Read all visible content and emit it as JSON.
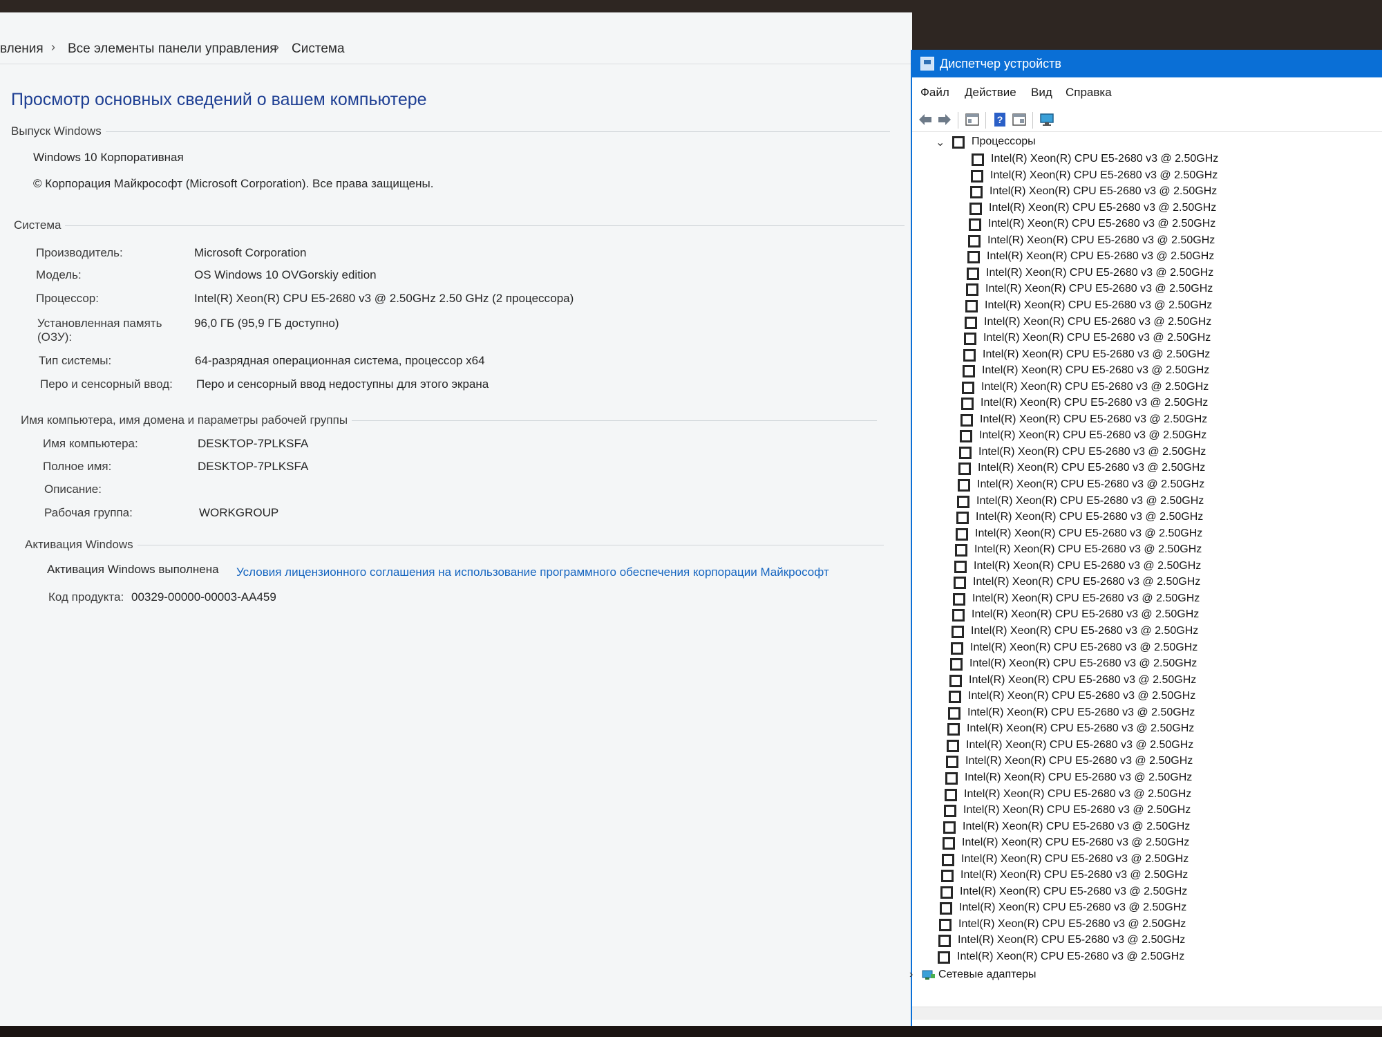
{
  "system_window": {
    "breadcrumb": [
      "вления",
      "Все элементы панели управления",
      "Система"
    ],
    "page_title": "Просмотр основных сведений о вашем компьютере",
    "windows_edition": {
      "heading": "Выпуск Windows",
      "edition": "Windows 10 Корпоративная",
      "copyright": "© Корпорация Майкрософт (Microsoft Corporation). Все права защищены."
    },
    "system": {
      "heading": "Система",
      "manufacturer_label": "Производитель:",
      "manufacturer_value": "Microsoft Corporation",
      "model_label": "Модель:",
      "model_value": "OS Windows 10 OVGorskiy edition",
      "processor_label": "Процессор:",
      "processor_value": "Intel(R) Xeon(R) CPU E5-2680 v3 @ 2.50GHz   2.50 GHz  (2 процессора)",
      "memory_label_1": "Установленная память",
      "memory_label_2": "(ОЗУ):",
      "memory_value": "96,0 ГБ (95,9 ГБ доступно)",
      "system_type_label": "Тип системы:",
      "system_type_value": "64-разрядная операционная система, процессор x64",
      "pen_label": "Перо и сенсорный ввод:",
      "pen_value": "Перо и сенсорный ввод недоступны для этого экрана"
    },
    "computer_name": {
      "heading": "Имя компьютера, имя домена и параметры рабочей группы",
      "name_label": "Имя компьютера:",
      "name_value": "DESKTOP-7PLKSFA",
      "full_name_label": "Полное имя:",
      "full_name_value": "DESKTOP-7PLKSFA",
      "description_label": "Описание:",
      "workgroup_label": "Рабочая группа:",
      "workgroup_value": "WORKGROUP"
    },
    "activation": {
      "heading": "Активация Windows",
      "status": "Активация Windows выполнена",
      "license_link": "Условия лицензионного соглашения на использование программного обеспечения корпорации Майкрософт",
      "product_key_label": "Код продукта:",
      "product_key_value": "00329-00000-00003-AA459"
    }
  },
  "device_manager": {
    "title": "Диспетчер устройств",
    "menu": [
      "Файл",
      "Действие",
      "Вид",
      "Справка"
    ],
    "toolbar_icons": [
      "back-arrow-icon",
      "forward-arrow-icon",
      "properties-icon",
      "help-icon",
      "details-view-icon",
      "monitor-icon"
    ],
    "category_processors": "Процессоры",
    "processor_item": "Intel(R) Xeon(R) CPU E5-2680 v3 @ 2.50GHz",
    "category_network": "Сетевые адаптеры",
    "colors": {
      "title_bar": "#0a6fd6",
      "link": "#1565c0",
      "page_title": "#1e3f93"
    }
  }
}
